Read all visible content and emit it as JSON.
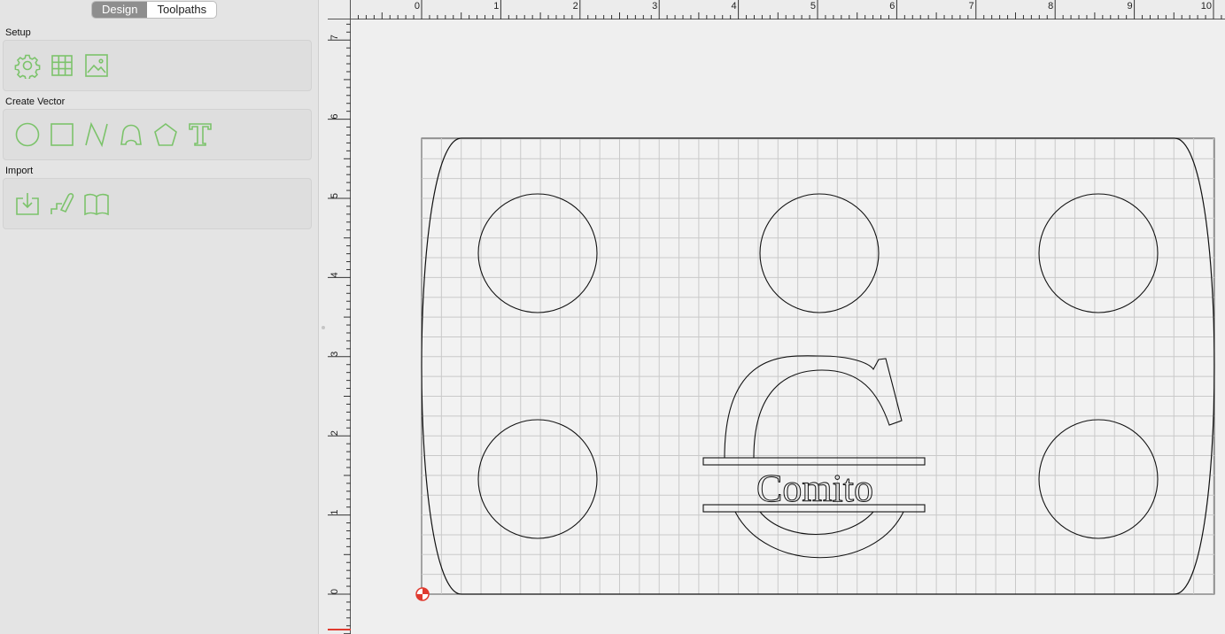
{
  "tabs": {
    "design": "Design",
    "toolpaths": "Toolpaths"
  },
  "sections": {
    "setup": {
      "title": "Setup",
      "tools": [
        "gear-icon",
        "grid-icon",
        "image-icon"
      ]
    },
    "create_vector": {
      "title": "Create Vector",
      "tools": [
        "circle-icon",
        "rectangle-icon",
        "pen-icon",
        "shape-icon",
        "polygon-icon",
        "text-icon"
      ]
    },
    "import": {
      "title": "Import",
      "tools": [
        "import-icon",
        "trace-icon",
        "library-icon"
      ]
    }
  },
  "ruler": {
    "x_labels": [
      "0",
      "1",
      "2",
      "3",
      "4",
      "5",
      "6",
      "7",
      "8",
      "9",
      "10"
    ],
    "y_labels": [
      "0",
      "1",
      "2",
      "3",
      "4",
      "5",
      "6",
      "7"
    ]
  },
  "design": {
    "text": "Comito",
    "stroke_color": "#111111",
    "grid_color": "#c9c9c9",
    "origin_color": "#e03a2f"
  },
  "colors": {
    "accent_icon": "#7cc36b",
    "active_tab": "#8e8e8e"
  }
}
